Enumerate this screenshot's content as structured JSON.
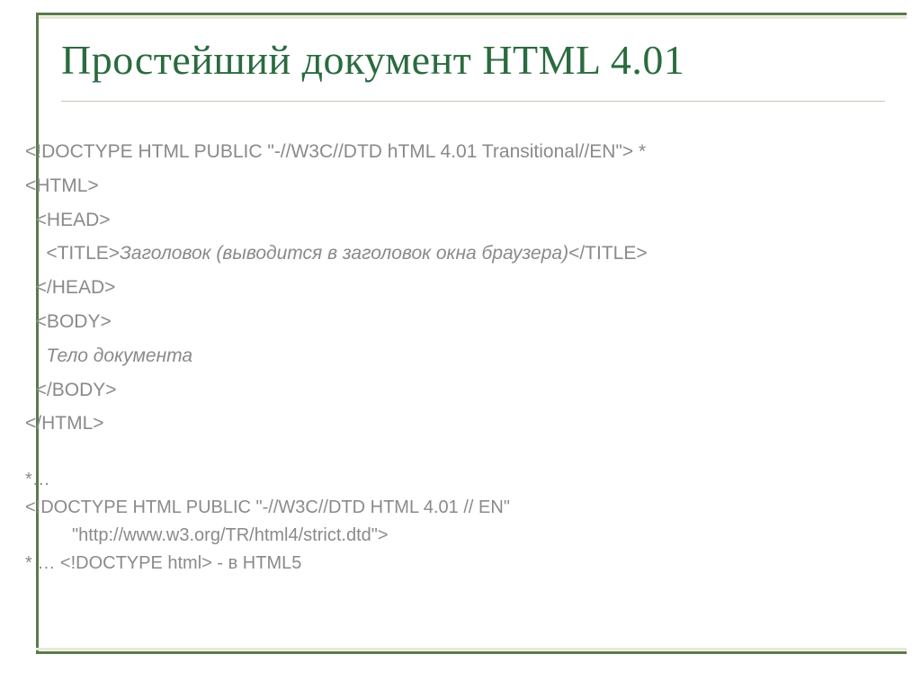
{
  "title": "Простейший документ HTML 4.01",
  "code": {
    "l1": "<!DOCTYPE HTML PUBLIC \"-//W3C//DTD hTML 4.01 Transitional//EN\">",
    "l1_star": " *",
    "l2": "<HTML>",
    "l3": "  <HEAD>",
    "l4a": "    <TITLE>",
    "l4b": "Заголовок (выводится в заголовок окна браузера)",
    "l4c": "</TITLE>",
    "l5": "  </HEAD>",
    "l6": "  <BODY>",
    "l7": "    Тело документа",
    "l8": "  </BODY>",
    "l9": "</HTML>"
  },
  "footer": {
    "f1": "*…",
    "f2a": "<!DOCTYPE  HTML PUBLIC \"-//W3C//DTD HTML 4.01 // EN\"",
    "f2b": "\"http://www.w3.org/TR/html4/strict.dtd\">",
    "f3": "* … <!DOCTYPE html> - в HTML5"
  }
}
